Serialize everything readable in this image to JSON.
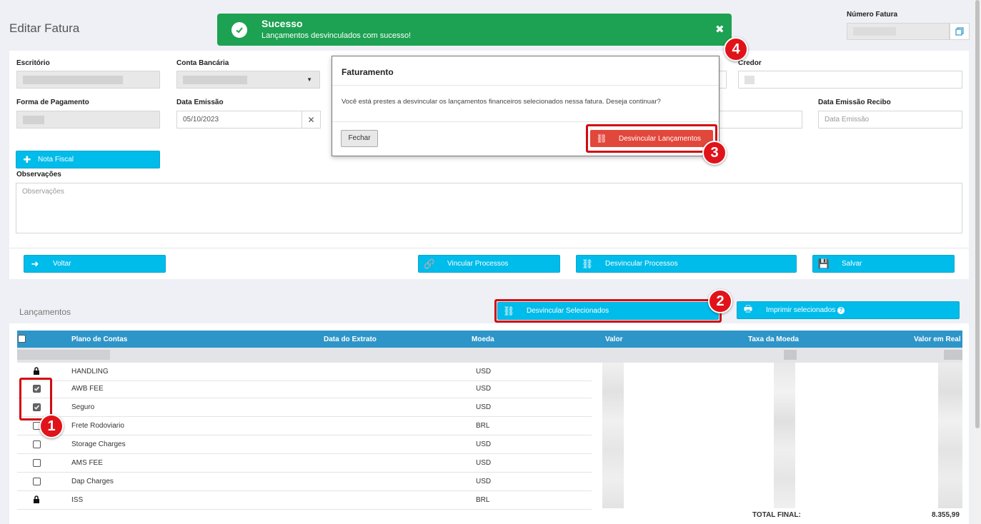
{
  "page": {
    "title": "Editar Fatura"
  },
  "toast": {
    "title": "Sucesso",
    "message": "Lançamentos desvinculados com sucesso!",
    "close_icon": "times-icon",
    "color": "#1da152"
  },
  "invoice_number": {
    "label": "Número Fatura",
    "copy_icon": "copy-icon"
  },
  "form": {
    "escritorio_label": "Escritório",
    "conta_label": "Conta Bancária",
    "credor_label": "Credor",
    "forma_label": "Forma de Pagamento",
    "data_emissao_label": "Data Emissão",
    "data_emissao_value": "05/10/2023",
    "data_recibo_label": "Data Emissão Recibo",
    "data_recibo_placeholder": "Data Emissão",
    "nota_fiscal_button": "Nota Fiscal",
    "observacoes_label": "Observações",
    "observacoes_placeholder": "Observações"
  },
  "actions": {
    "voltar": "Voltar",
    "vincular": "Vincular Processos",
    "desvincular": "Desvincular Processos",
    "salvar": "Salvar"
  },
  "modal": {
    "title": "Faturamento",
    "body": "Você está prestes a desvincular os lançamentos financeiros selecionados nessa fatura. Deseja continuar?",
    "close_button": "Fechar",
    "confirm_button": "Desvincular Lançamentos",
    "confirm_color": "#e2473b"
  },
  "lancamentos": {
    "title": "Lançamentos",
    "desvincular_selecionados": "Desvincular Selecionados",
    "imprimir_selecionados": "Imprimir selecionados",
    "columns": [
      "Plano de Contas",
      "Data do Extrato",
      "Moeda",
      "Valor",
      "Taxa da Moeda",
      "Valor em Real"
    ],
    "rows": [
      {
        "state": "locked",
        "plano": "HANDLING",
        "moeda": "USD"
      },
      {
        "state": "checked",
        "plano": "AWB FEE",
        "moeda": "USD"
      },
      {
        "state": "checked",
        "plano": "Seguro",
        "moeda": "USD"
      },
      {
        "state": "unchecked",
        "plano": "Frete Rodoviario",
        "moeda": "BRL"
      },
      {
        "state": "unchecked",
        "plano": "Storage Charges",
        "moeda": "USD"
      },
      {
        "state": "unchecked",
        "plano": "AMS FEE",
        "moeda": "USD"
      },
      {
        "state": "unchecked",
        "plano": "Dap Charges",
        "moeda": "USD"
      },
      {
        "state": "locked",
        "plano": "ISS",
        "moeda": "BRL"
      }
    ],
    "total_label": "TOTAL FINAL:",
    "total_value": "8.355,99"
  },
  "annotations": [
    "1",
    "2",
    "3",
    "4"
  ]
}
